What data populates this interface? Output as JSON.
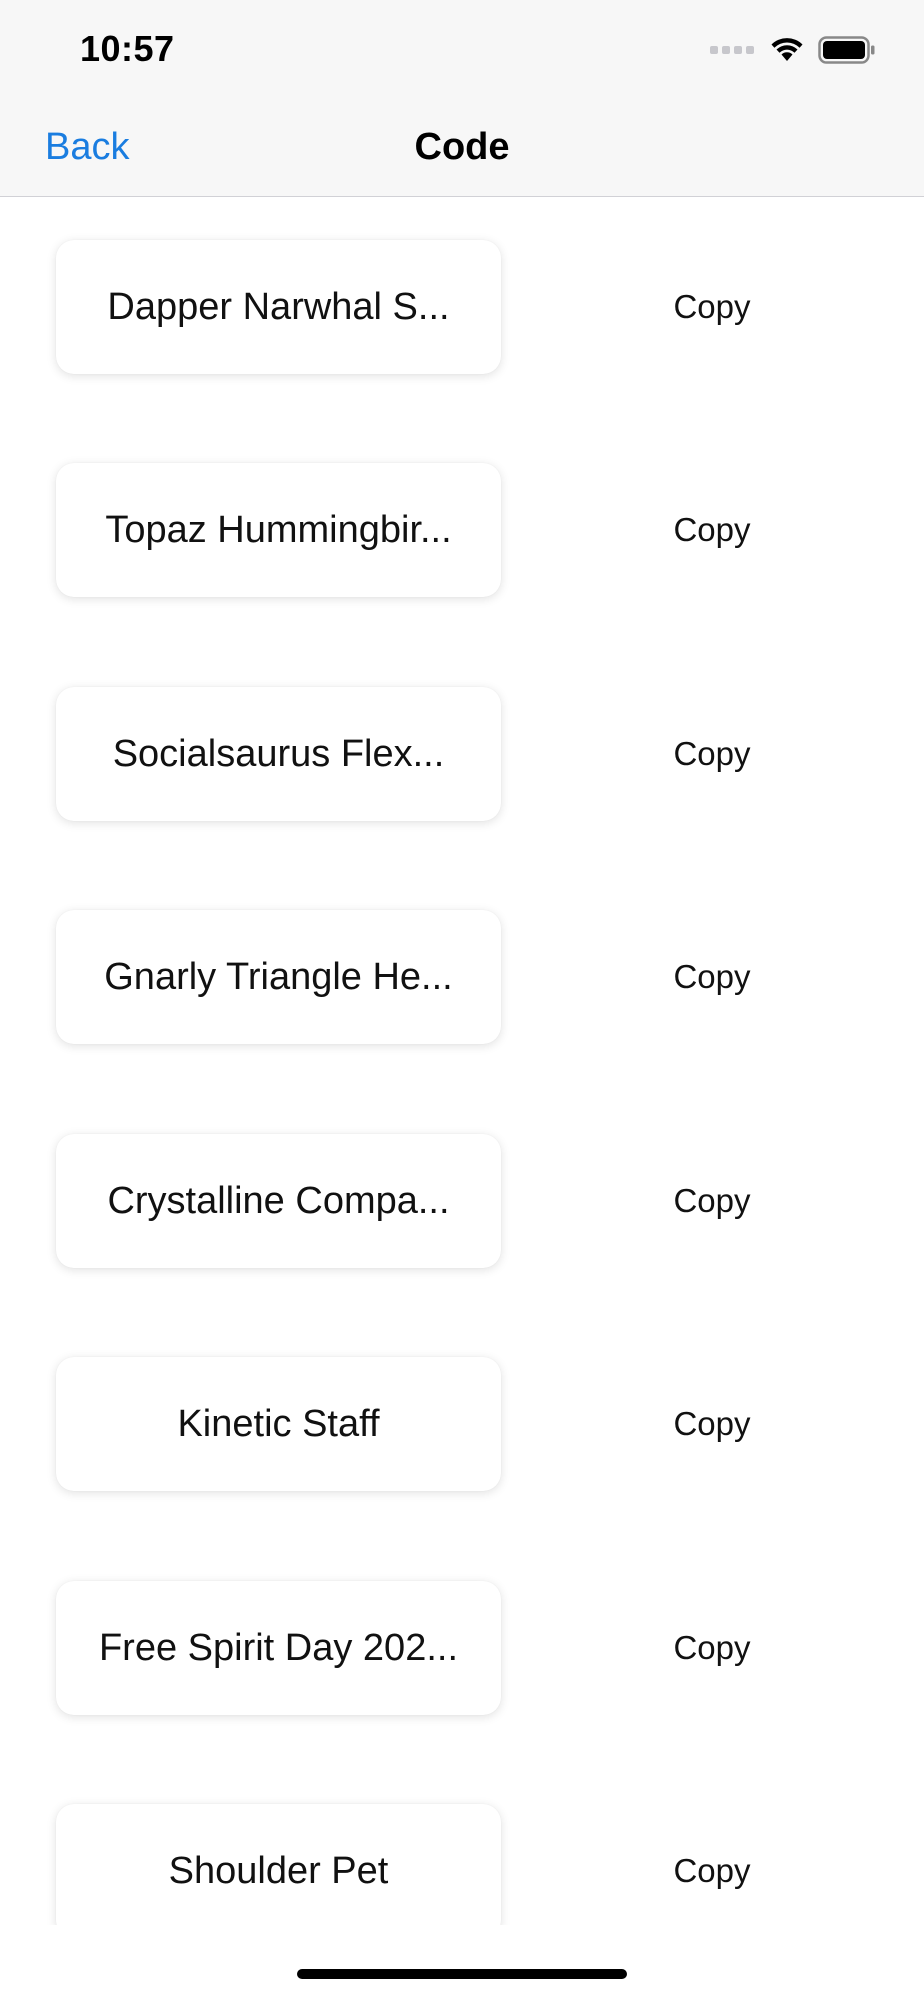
{
  "status_bar": {
    "time": "10:57",
    "icons": [
      "cellular-signal-icon",
      "wifi-icon",
      "battery-icon"
    ]
  },
  "nav": {
    "back_label": "Back",
    "title": "Code"
  },
  "colors": {
    "accent": "#1a7de0",
    "chrome_background": "#f7f7f7",
    "background": "#ffffff"
  },
  "items": [
    {
      "label": "Dapper Narwhal S...",
      "action": "Copy"
    },
    {
      "label": "Topaz Hummingbir...",
      "action": "Copy"
    },
    {
      "label": "Socialsaurus Flex...",
      "action": "Copy"
    },
    {
      "label": "Gnarly Triangle He...",
      "action": "Copy"
    },
    {
      "label": "Crystalline Compa...",
      "action": "Copy"
    },
    {
      "label": "Kinetic Staff",
      "action": "Copy"
    },
    {
      "label": "Free Spirit Day 202...",
      "action": "Copy"
    },
    {
      "label": "Shoulder Pet",
      "action": "Copy"
    }
  ]
}
